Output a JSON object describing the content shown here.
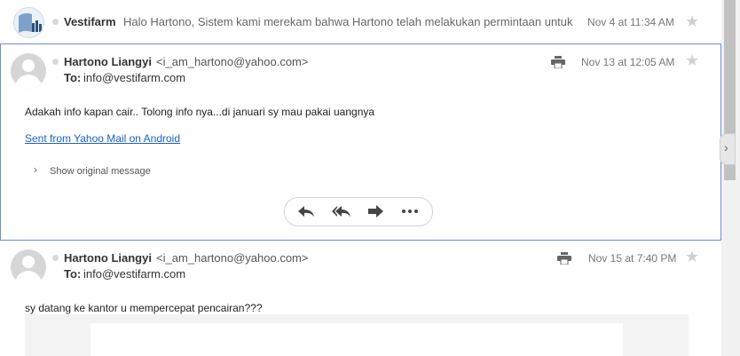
{
  "rows": [
    {
      "sender": "Vestifarm",
      "snippet": "Halo Hartono, Sistem kami merekam bahwa Hartono telah melakukan permintaan untuk",
      "date": "Nov 4 at 11:34 AM"
    }
  ],
  "messages": [
    {
      "sender": "Hartono Liangyi",
      "email": "<i_am_hartono@yahoo.com>",
      "to_label": "To:",
      "to": "info@vestifarm.com",
      "date": "Nov 13 at 12:05 AM",
      "body": "Adakah info kapan cair.. Tolong info nya...di januari sy mau pakai uangnya",
      "link": "Sent from Yahoo Mail on Android",
      "original": "Show original message"
    },
    {
      "sender": "Hartono Liangyi",
      "email": "<i_am_hartono@yahoo.com>",
      "to_label": "To:",
      "to": "info@vestifarm.com",
      "date": "Nov 15 at 7:40 PM",
      "body": "sy datang ke kantor u mempercepat pencairan???"
    }
  ],
  "icons": {
    "reply": "reply-icon",
    "reply_all": "reply-all-icon",
    "forward": "forward-icon",
    "more": "more-icon",
    "print": "print-icon",
    "star": "star-icon"
  },
  "colors": {
    "link": "#1a62c7",
    "selected_border": "#6b8fd6"
  }
}
